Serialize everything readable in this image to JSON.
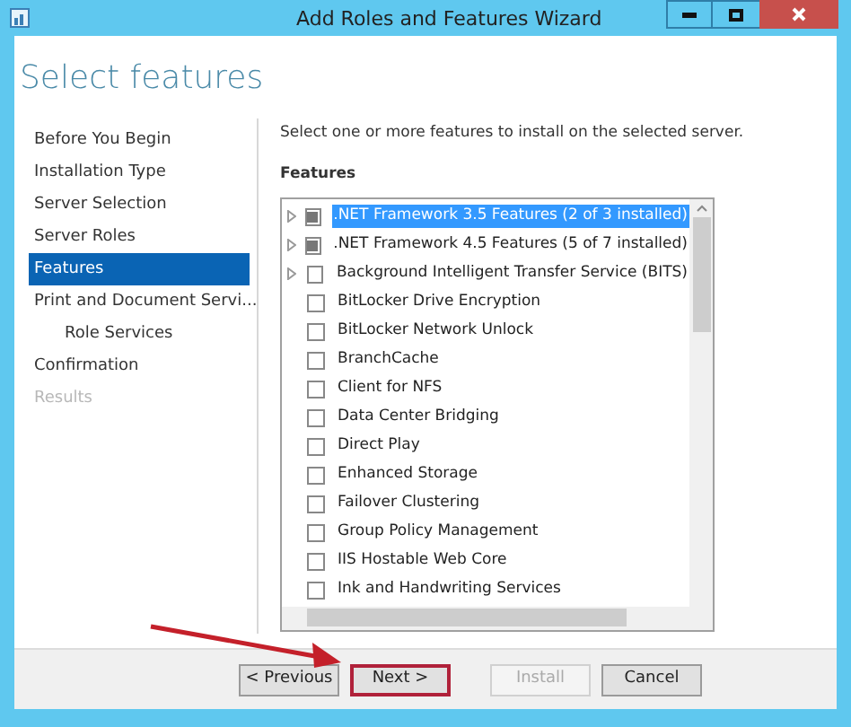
{
  "window": {
    "title": "Add Roles and Features Wizard"
  },
  "heading": "Select features",
  "nav": [
    {
      "label": "Before You Begin",
      "selected": false,
      "disabled": false
    },
    {
      "label": "Installation Type",
      "selected": false,
      "disabled": false
    },
    {
      "label": "Server Selection",
      "selected": false,
      "disabled": false
    },
    {
      "label": "Server Roles",
      "selected": false,
      "disabled": false
    },
    {
      "label": "Features",
      "selected": true,
      "disabled": false
    },
    {
      "label": "Print and Document Servi...",
      "selected": false,
      "disabled": false,
      "children": [
        {
          "label": "Role Services",
          "selected": false,
          "disabled": false
        }
      ]
    },
    {
      "label": "Confirmation",
      "selected": false,
      "disabled": false
    },
    {
      "label": "Results",
      "selected": false,
      "disabled": true
    }
  ],
  "description": "Select one or more features to install on the selected server.",
  "features_label": "Features",
  "features": [
    {
      "label": ".NET Framework 3.5 Features (2 of 3 installed)",
      "expandable": true,
      "partial": true,
      "selected": true
    },
    {
      "label": ".NET Framework 4.5 Features (5 of 7 installed)",
      "expandable": true,
      "partial": true,
      "selected": false
    },
    {
      "label": "Background Intelligent Transfer Service (BITS)",
      "expandable": true,
      "partial": false,
      "selected": false
    },
    {
      "label": "BitLocker Drive Encryption",
      "expandable": false,
      "partial": false,
      "selected": false
    },
    {
      "label": "BitLocker Network Unlock",
      "expandable": false,
      "partial": false,
      "selected": false
    },
    {
      "label": "BranchCache",
      "expandable": false,
      "partial": false,
      "selected": false
    },
    {
      "label": "Client for NFS",
      "expandable": false,
      "partial": false,
      "selected": false
    },
    {
      "label": "Data Center Bridging",
      "expandable": false,
      "partial": false,
      "selected": false
    },
    {
      "label": "Direct Play",
      "expandable": false,
      "partial": false,
      "selected": false
    },
    {
      "label": "Enhanced Storage",
      "expandable": false,
      "partial": false,
      "selected": false
    },
    {
      "label": "Failover Clustering",
      "expandable": false,
      "partial": false,
      "selected": false
    },
    {
      "label": "Group Policy Management",
      "expandable": false,
      "partial": false,
      "selected": false
    },
    {
      "label": "IIS Hostable Web Core",
      "expandable": false,
      "partial": false,
      "selected": false
    },
    {
      "label": "Ink and Handwriting Services",
      "expandable": false,
      "partial": false,
      "selected": false
    }
  ],
  "buttons": [
    {
      "label": "< Previous",
      "disabled": false,
      "highlighted": false
    },
    {
      "label": "Next >",
      "disabled": false,
      "highlighted": true
    },
    {
      "label": "Install",
      "disabled": true,
      "highlighted": false
    },
    {
      "label": "Cancel",
      "disabled": false,
      "highlighted": false
    }
  ]
}
